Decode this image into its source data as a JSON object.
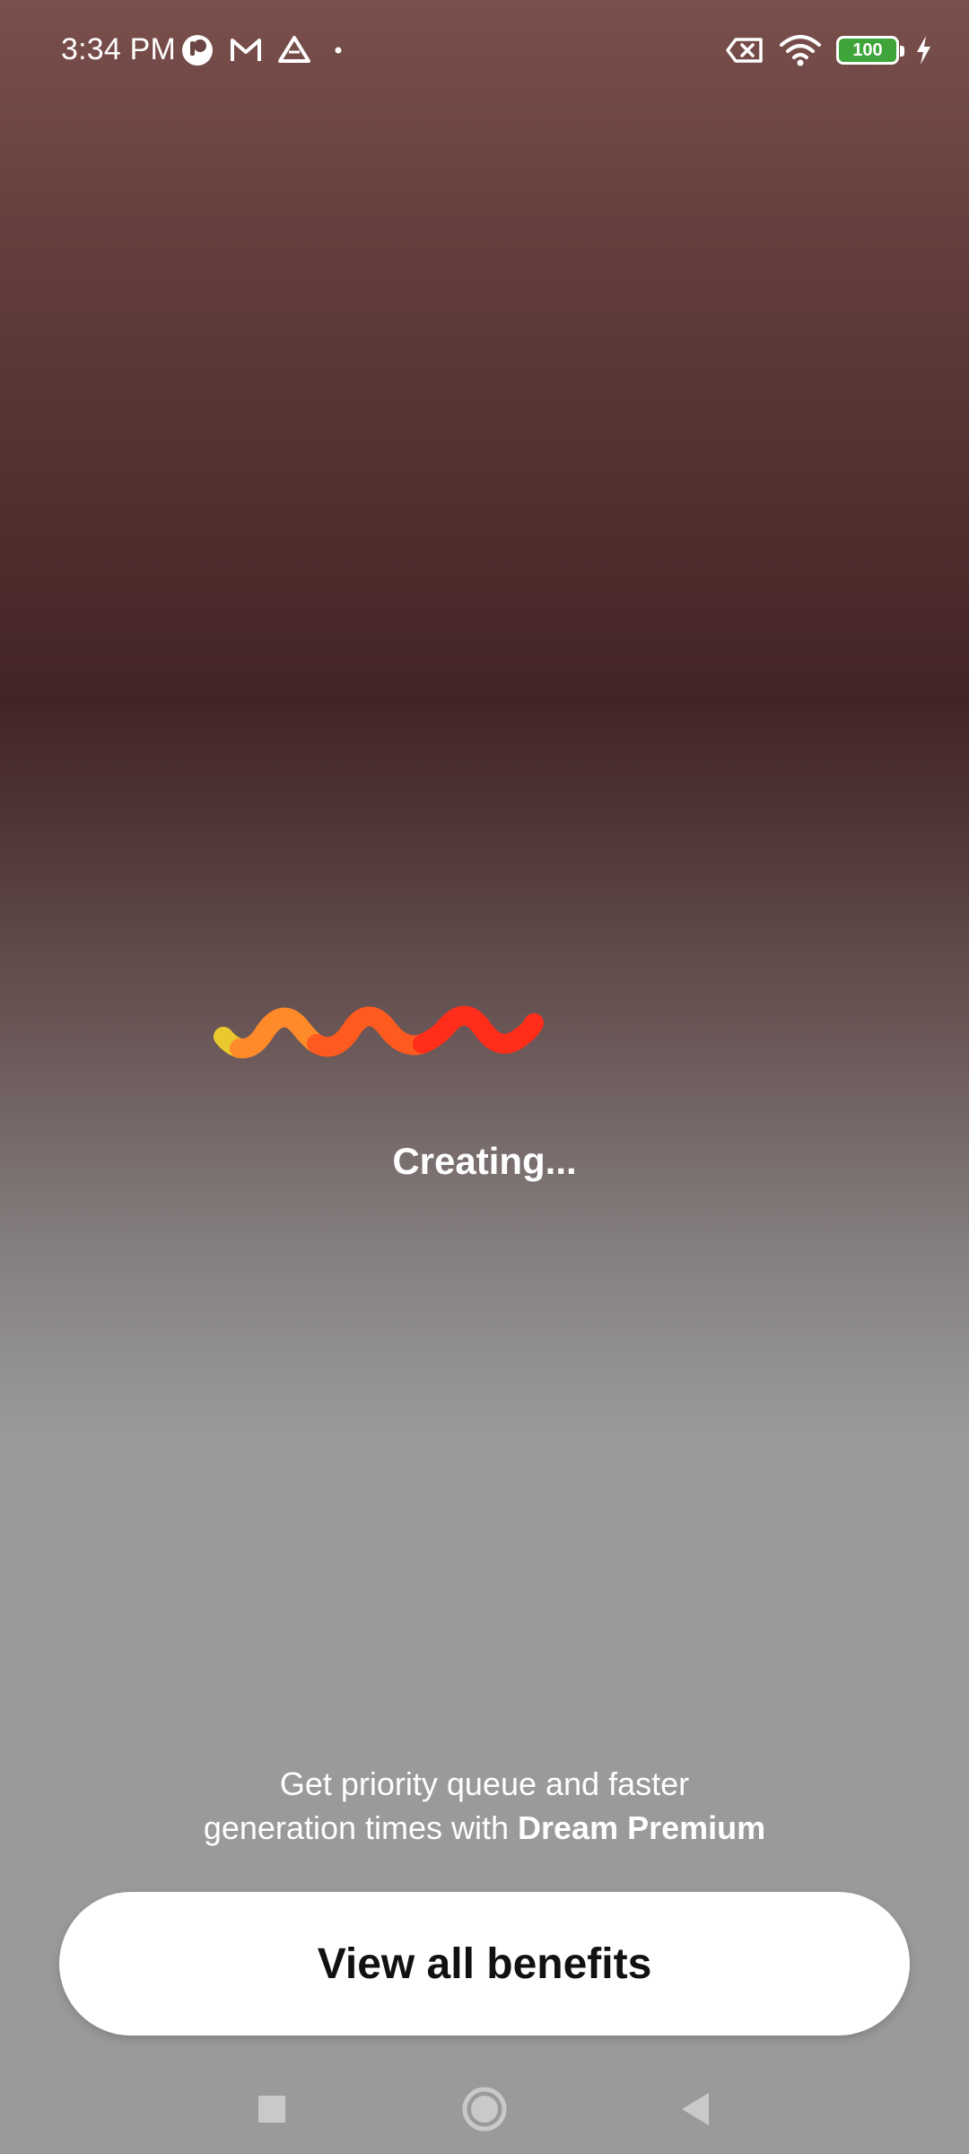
{
  "status_bar": {
    "time": "3:34 PM",
    "battery_level": "100",
    "left_icons": [
      "app-notification-icon",
      "gmail-icon",
      "drive-icon",
      "dot-icon"
    ],
    "right_icons": [
      "data-off-icon",
      "wifi-icon",
      "battery-icon",
      "charging-icon"
    ]
  },
  "loader": {
    "label": "Creating...",
    "colors": [
      "#e9c92e",
      "#ff8a2a",
      "#ff5a1f",
      "#ff2d1a"
    ]
  },
  "promo": {
    "line1": "Get priority queue and faster",
    "line2_prefix": "generation times with ",
    "line2_brand": "Dream Premium"
  },
  "cta": {
    "label": "View all benefits"
  },
  "nav": {
    "icons": [
      "recent-apps-icon",
      "home-icon",
      "back-icon"
    ]
  }
}
